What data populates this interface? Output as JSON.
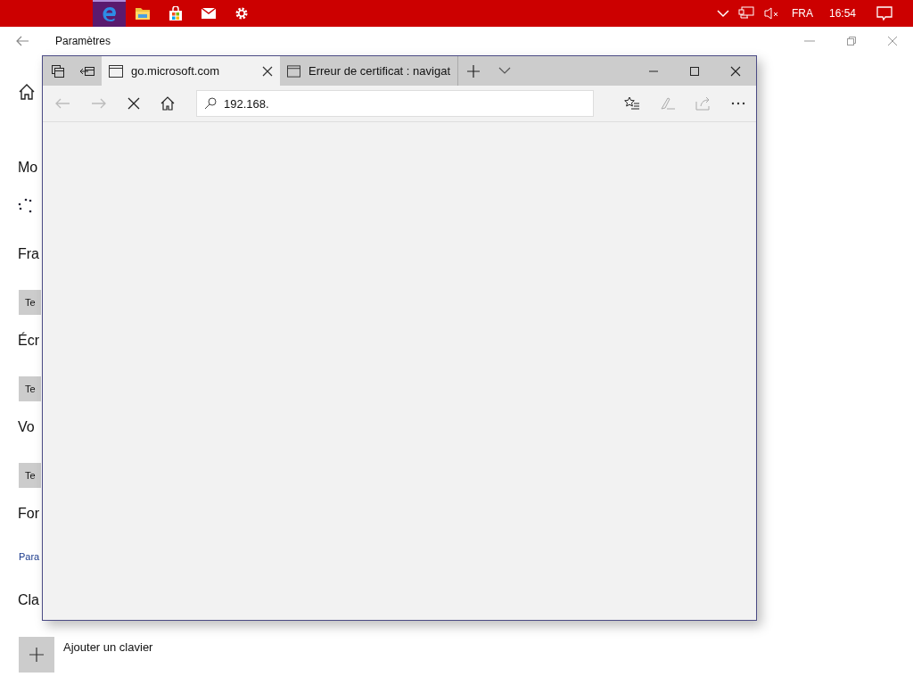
{
  "taskbar": {
    "apps": [
      {
        "kind": "edge",
        "selected": true
      },
      {
        "kind": "folder",
        "selected": false
      },
      {
        "kind": "store",
        "selected": false
      },
      {
        "kind": "mail",
        "selected": false
      },
      {
        "kind": "settings",
        "selected": false
      }
    ],
    "tray": {
      "language": "FRA",
      "time": "16:54"
    }
  },
  "settings_window": {
    "title": "Paramètres",
    "sections": [
      {
        "kind": "loading",
        "heading": "Mo"
      },
      {
        "kind": "button",
        "heading": "Fra",
        "label": "Te"
      },
      {
        "kind": "button",
        "heading": "Écr",
        "label": "Te"
      },
      {
        "kind": "button",
        "heading": "Vo",
        "label": "Te"
      },
      {
        "kind": "link",
        "heading": "For",
        "label": "Para"
      },
      {
        "kind": "add",
        "heading": "Cla",
        "label": "Ajouter un clavier"
      }
    ]
  },
  "browser": {
    "tabs": [
      {
        "title": "go.microsoft.com",
        "selected": true
      },
      {
        "title": "Erreur de certificat : navigat",
        "selected": false
      }
    ],
    "address": {
      "value": "192.168."
    },
    "loading": true
  }
}
